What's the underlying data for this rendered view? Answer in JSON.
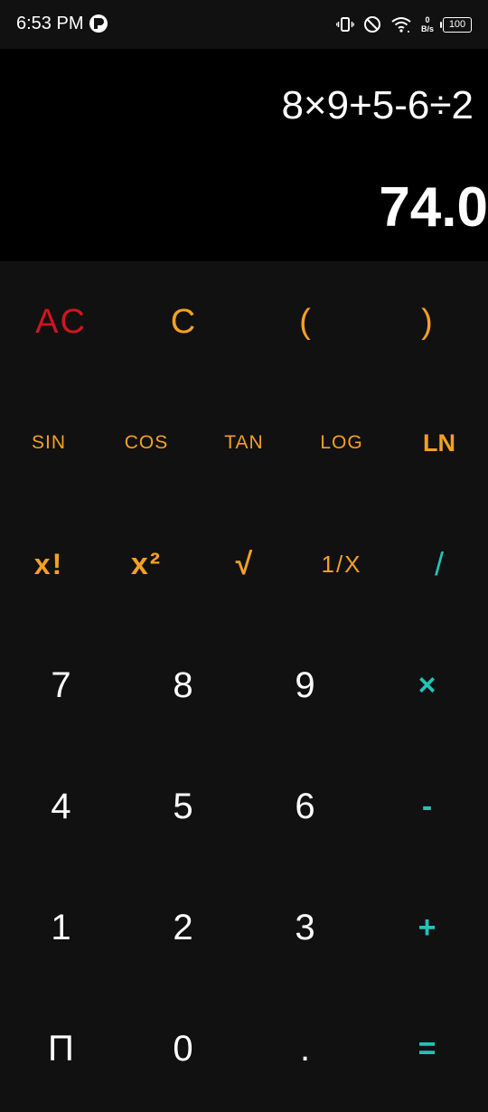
{
  "status_bar": {
    "time": "6:53 PM",
    "net_speed_value": "0",
    "net_speed_unit": "B/s",
    "battery": "100"
  },
  "display": {
    "expression": "8×9+5-6÷2",
    "result": "74.0"
  },
  "keys": {
    "row1": [
      "AC",
      "C",
      "(",
      ")"
    ],
    "row2": [
      "SIN",
      "COS",
      "TAN",
      "LOG",
      "LN"
    ],
    "row3": [
      "x!",
      "x²",
      "√",
      "1/X",
      "/"
    ],
    "row4": [
      "7",
      "8",
      "9",
      "×"
    ],
    "row5": [
      "4",
      "5",
      "6",
      "-"
    ],
    "row6": [
      "1",
      "2",
      "3",
      "+"
    ],
    "row7": [
      "Π",
      "0",
      ".",
      "="
    ]
  },
  "colors": {
    "background": "#111111",
    "display_background": "#000000",
    "function_orange": "#f5a023",
    "clear_red": "#d0141f",
    "operator_teal": "#22c3b5",
    "digit_white": "#ffffff"
  }
}
